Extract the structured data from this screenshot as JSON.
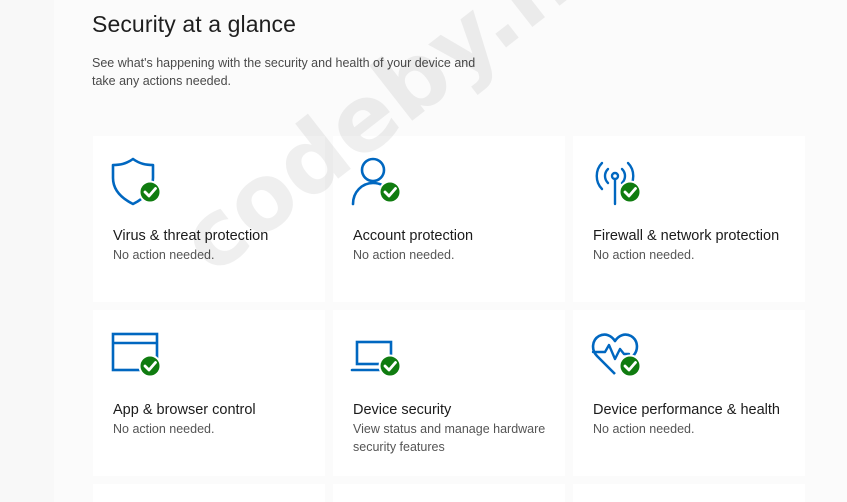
{
  "page": {
    "title": "Security at a glance",
    "subtitle": "See what's happening with the security and health of your device and take any actions needed."
  },
  "tiles": [
    {
      "title": "Virus & threat protection",
      "status": "No action needed.",
      "icon": "shield-icon"
    },
    {
      "title": "Account protection",
      "status": "No action needed.",
      "icon": "person-icon"
    },
    {
      "title": "Firewall & network protection",
      "status": "No action needed.",
      "icon": "antenna-icon"
    },
    {
      "title": "App & browser control",
      "status": "No action needed.",
      "icon": "browser-window-icon"
    },
    {
      "title": "Device security",
      "status": "View status and manage hardware security features",
      "icon": "laptop-icon"
    },
    {
      "title": "Device performance & health",
      "status": "No action needed.",
      "icon": "heart-pulse-icon"
    }
  ],
  "watermark": "codeby.net",
  "colors": {
    "accent": "#0067c0",
    "ok_badge": "#107c10"
  }
}
